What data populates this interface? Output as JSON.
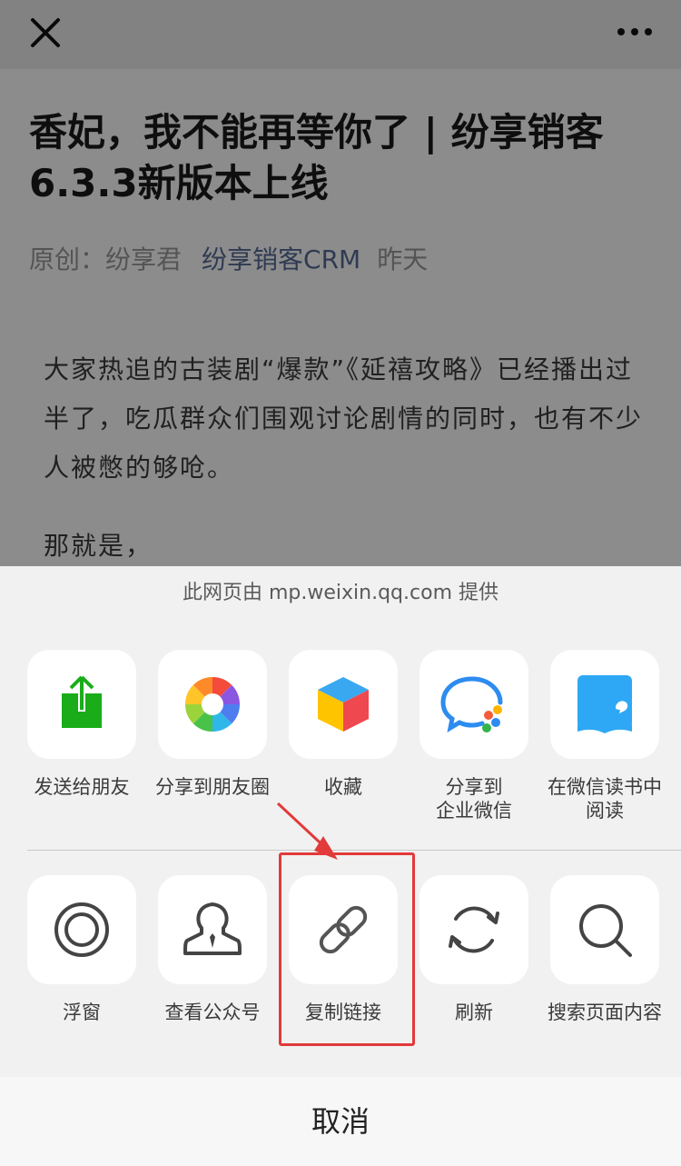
{
  "article": {
    "title_line1": "香妃，我不能再等你了 | 纷享销客",
    "title_line2": "6.3.3新版本上线",
    "meta_prefix": "原创：纷享君",
    "account": "纷享销客CRM",
    "date": "昨天",
    "paragraph1": "大家热追的古装剧“爆款”《延禧攻略》已经播出过半了，吃瓜群众们围观讨论剧情的同时，也有不少人被憋的够呛。",
    "paragraph2": "那就是，"
  },
  "sheet": {
    "provider": "此网页由 mp.weixin.qq.com 提供",
    "row1": [
      {
        "label": "发送给朋友",
        "icon": "send-to-friend-icon"
      },
      {
        "label": "分享到朋友圈",
        "icon": "moments-icon"
      },
      {
        "label": "收藏",
        "icon": "favorites-cube-icon"
      },
      {
        "label": "分享到\n企业微信",
        "icon": "wecom-icon"
      },
      {
        "label": "在微信读书中\n阅读",
        "icon": "weread-icon"
      }
    ],
    "row2": [
      {
        "label": "浮窗",
        "icon": "floating-window-icon"
      },
      {
        "label": "查看公众号",
        "icon": "official-account-icon"
      },
      {
        "label": "复制链接",
        "icon": "link-icon"
      },
      {
        "label": "刷新",
        "icon": "refresh-icon"
      },
      {
        "label": "搜索页面内容",
        "icon": "search-icon"
      }
    ],
    "cancel": "取消",
    "highlight_color": "#e23a3a"
  }
}
